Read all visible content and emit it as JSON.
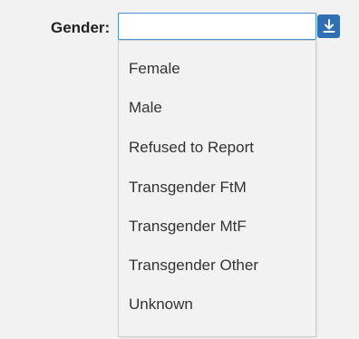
{
  "field": {
    "label": "Gender:",
    "value": "",
    "placeholder": ""
  },
  "dropdown_button": {
    "icon": "download-arrow-icon",
    "color": "#2f6fb3"
  },
  "options": [
    "Female",
    "Male",
    "Refused to Report",
    "Transgender FtM",
    "Transgender MtF",
    "Transgender Other",
    "Unknown"
  ]
}
